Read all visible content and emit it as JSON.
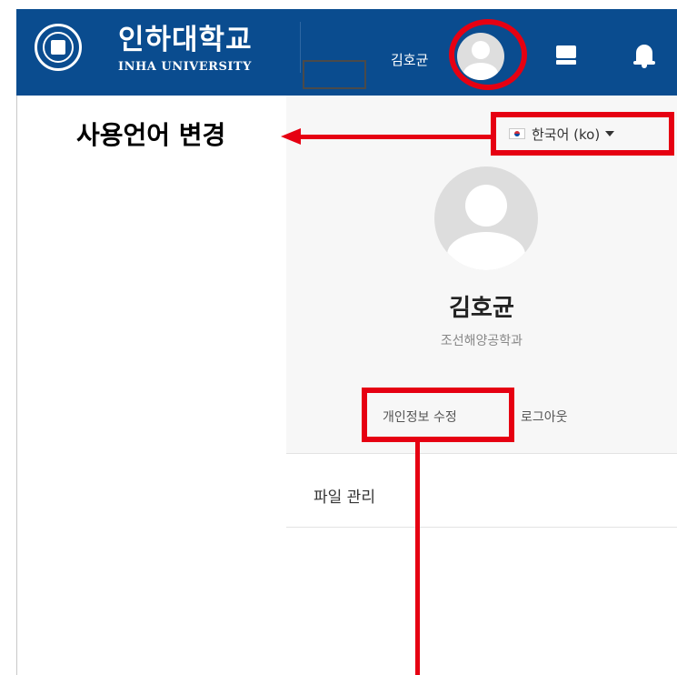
{
  "header": {
    "logo_korean": "인하대학교",
    "logo_english": "INHA UNIVERSITY",
    "username": "김호균",
    "background_color": "#0a4c8f"
  },
  "user_menu": {
    "language_selector": "한국어 (ko)",
    "display_name": "김호균",
    "department": "조선해양공학과",
    "edit_profile_label": "개인정보 수정",
    "logout_label": "로그아웃",
    "file_manager_label": "파일 관리"
  },
  "annotations": {
    "change_language_callout": "사용언어 변경",
    "highlight_color": "#e60012"
  },
  "icons": [
    "user-avatar-icon",
    "monitor-icon",
    "bell-icon",
    "korea-flag-icon",
    "chevron-down-icon"
  ]
}
